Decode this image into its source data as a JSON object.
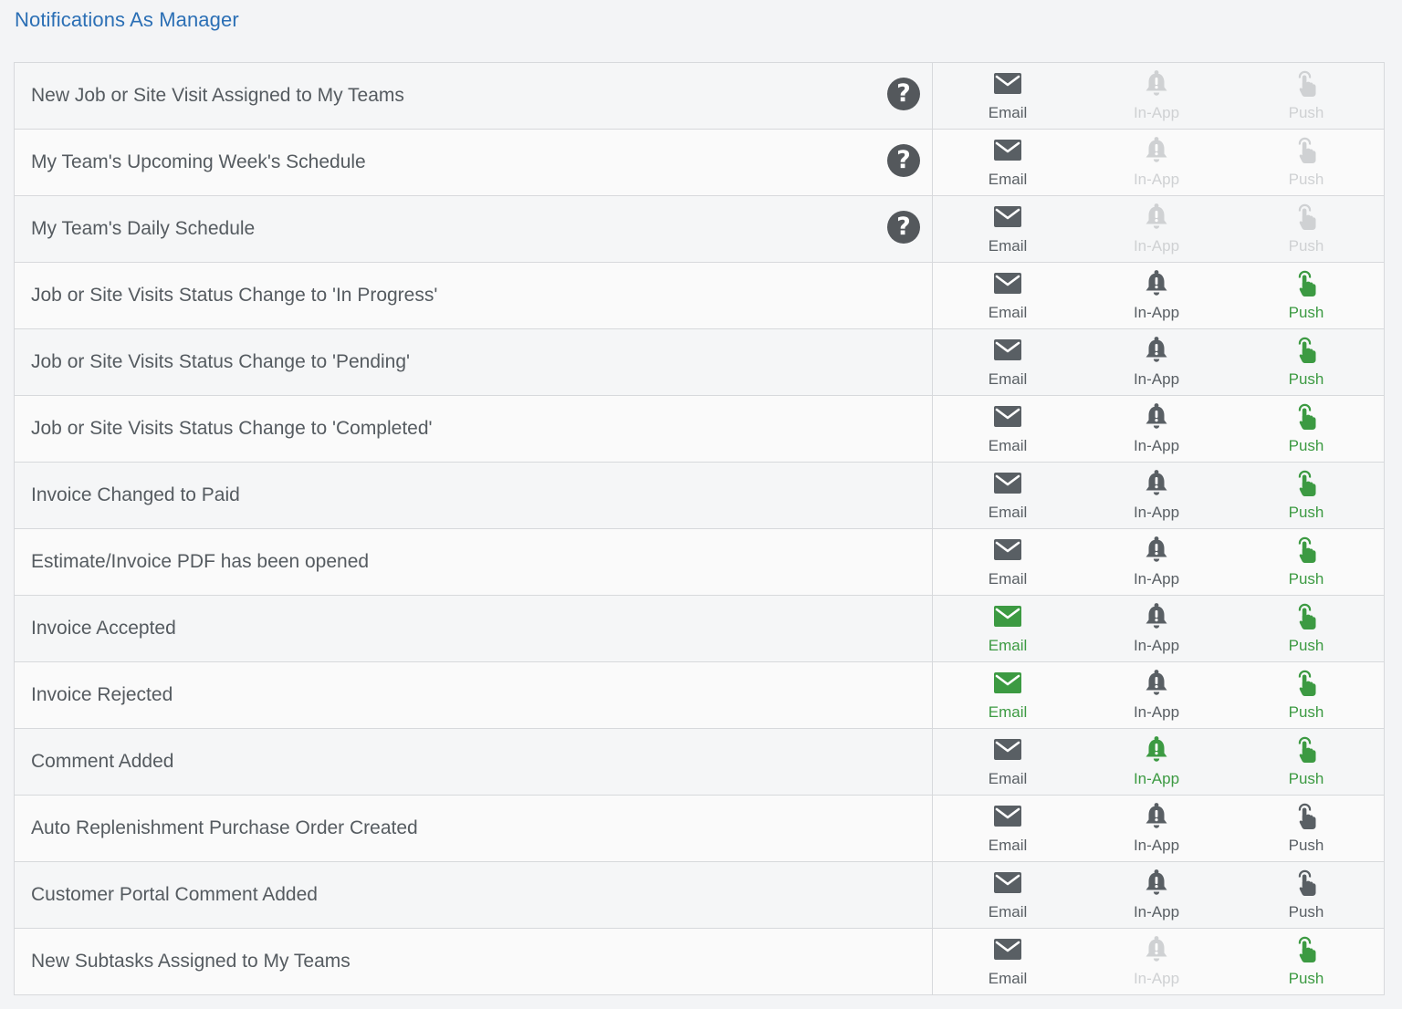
{
  "title": "Notifications As Manager",
  "colors": {
    "on": "#3c9a42",
    "off": "#595f64",
    "disabled": "#cfd1d3",
    "title": "#2b6fb5"
  },
  "channel_labels": {
    "email": "Email",
    "inapp": "In-App",
    "push": "Push"
  },
  "icons": {
    "email": "envelope-icon",
    "inapp": "bell-icon",
    "push": "hand-tap-icon",
    "help": "question-circle-icon"
  },
  "rows": [
    {
      "label": "New Job or Site Visit Assigned to My Teams",
      "help": true,
      "email": "off",
      "inapp": "disabled",
      "push": "disabled"
    },
    {
      "label": "My Team's Upcoming Week's Schedule",
      "help": true,
      "email": "off",
      "inapp": "disabled",
      "push": "disabled"
    },
    {
      "label": "My Team's Daily Schedule",
      "help": true,
      "email": "off",
      "inapp": "disabled",
      "push": "disabled"
    },
    {
      "label": "Job or Site Visits Status Change to 'In Progress'",
      "help": false,
      "email": "off",
      "inapp": "off",
      "push": "on"
    },
    {
      "label": "Job or Site Visits Status Change to 'Pending'",
      "help": false,
      "email": "off",
      "inapp": "off",
      "push": "on"
    },
    {
      "label": "Job or Site Visits Status Change to 'Completed'",
      "help": false,
      "email": "off",
      "inapp": "off",
      "push": "on"
    },
    {
      "label": "Invoice Changed to Paid",
      "help": false,
      "email": "off",
      "inapp": "off",
      "push": "on"
    },
    {
      "label": "Estimate/Invoice PDF has been opened",
      "help": false,
      "email": "off",
      "inapp": "off",
      "push": "on"
    },
    {
      "label": "Invoice Accepted",
      "help": false,
      "email": "on",
      "inapp": "off",
      "push": "on"
    },
    {
      "label": "Invoice Rejected",
      "help": false,
      "email": "on",
      "inapp": "off",
      "push": "on"
    },
    {
      "label": "Comment Added",
      "help": false,
      "email": "off",
      "inapp": "on",
      "push": "on"
    },
    {
      "label": "Auto Replenishment Purchase Order Created",
      "help": false,
      "email": "off",
      "inapp": "off",
      "push": "off"
    },
    {
      "label": "Customer Portal Comment Added",
      "help": false,
      "email": "off",
      "inapp": "off",
      "push": "off"
    },
    {
      "label": "New Subtasks Assigned to My Teams",
      "help": false,
      "email": "off",
      "inapp": "disabled",
      "push": "on"
    }
  ]
}
